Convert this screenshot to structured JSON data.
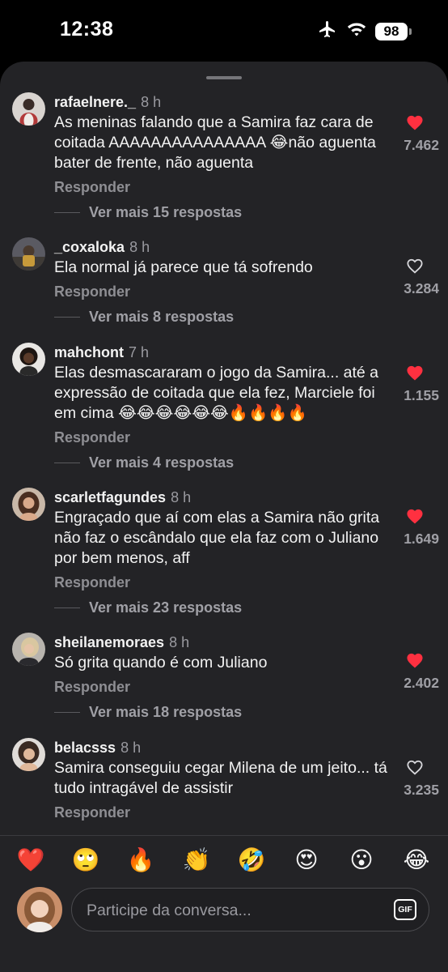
{
  "status_bar": {
    "time": "12:38",
    "battery": "98",
    "icons": [
      "airplane-icon",
      "wifi-icon",
      "battery-icon"
    ]
  },
  "comments": [
    {
      "username": "rafaelnere._",
      "time": "8 h",
      "text": "As meninas falando que a Samira faz cara de coitada AAAAAAAAAAAAAAA 😂não aguenta bater de frente, não aguenta",
      "reply_label": "Responder",
      "more_replies": "Ver mais 15 respostas",
      "likes": "7.462",
      "liked": true
    },
    {
      "username": "_coxaloka",
      "time": "8 h",
      "text": "Ela normal já parece que tá sofrendo",
      "reply_label": "Responder",
      "more_replies": "Ver mais 8 respostas",
      "likes": "3.284",
      "liked": false
    },
    {
      "username": "mahchont",
      "time": "7 h",
      "text": "Elas desmascararam o jogo da Samira... até a expressão de coitada que ela fez, Marciele foi em cima 😂😂😂😂😂😂🔥🔥🔥🔥",
      "reply_label": "Responder",
      "more_replies": "Ver mais 4 respostas",
      "likes": "1.155",
      "liked": true
    },
    {
      "username": "scarletfagundes",
      "time": "8 h",
      "text": "Engraçado que aí com elas a Samira não grita não faz o escândalo que ela faz com o Juliano por bem menos, aff",
      "reply_label": "Responder",
      "more_replies": "Ver mais 23 respostas",
      "likes": "1.649",
      "liked": true
    },
    {
      "username": "sheilanemoraes",
      "time": "8 h",
      "text": "Só grita quando é com Juliano",
      "reply_label": "Responder",
      "more_replies": "Ver mais 18 respostas",
      "likes": "2.402",
      "liked": true
    },
    {
      "username": "belacsss",
      "time": "8 h",
      "text": "Samira conseguiu cegar Milena de um jeito... tá tudo intragável de assistir",
      "reply_label": "Responder",
      "likes": "3.235",
      "liked": false
    }
  ],
  "emoji_bar": [
    "❤️",
    "🙄",
    "🔥",
    "👏",
    "🤣",
    "😍",
    "😮",
    "😂"
  ],
  "composer": {
    "placeholder": "Participe da conversa...",
    "gif_label": "GIF"
  },
  "colors": {
    "liked_heart": "#ff3040",
    "sheet_bg": "#232326",
    "muted_text": "#9a9aa0"
  }
}
